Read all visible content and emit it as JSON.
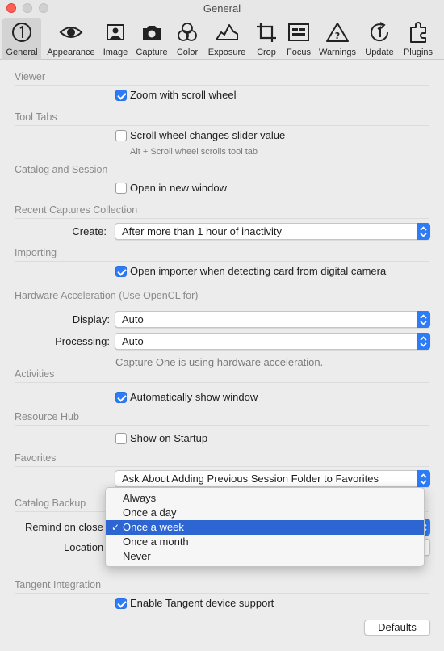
{
  "window": {
    "title": "General"
  },
  "toolbar": {
    "tabs": [
      {
        "label": "General",
        "icon": "general-icon"
      },
      {
        "label": "Appearance",
        "icon": "eye-icon"
      },
      {
        "label": "Image",
        "icon": "image-icon"
      },
      {
        "label": "Capture",
        "icon": "camera-icon"
      },
      {
        "label": "Color",
        "icon": "color-icon"
      },
      {
        "label": "Exposure",
        "icon": "exposure-icon"
      },
      {
        "label": "Crop",
        "icon": "crop-icon"
      },
      {
        "label": "Focus",
        "icon": "focus-icon"
      },
      {
        "label": "Warnings",
        "icon": "warning-icon"
      },
      {
        "label": "Update",
        "icon": "update-icon"
      },
      {
        "label": "Plugins",
        "icon": "plugin-icon"
      }
    ],
    "active": "General"
  },
  "viewer": {
    "title": "Viewer",
    "zoom_label": "Zoom with scroll wheel",
    "zoom_checked": true
  },
  "tool_tabs": {
    "title": "Tool Tabs",
    "scroll_label": "Scroll wheel changes slider value",
    "scroll_checked": false,
    "hint": "Alt + Scroll wheel scrolls tool tab"
  },
  "catalog_session": {
    "title": "Catalog and Session",
    "open_label": "Open in new window",
    "open_checked": false
  },
  "recent_captures": {
    "title": "Recent Captures Collection",
    "create_label": "Create:",
    "create_value": "After more than 1 hour of inactivity"
  },
  "importing": {
    "title": "Importing",
    "open_importer_label": "Open importer when detecting card from digital camera",
    "open_importer_checked": true
  },
  "hardware": {
    "title": "Hardware Acceleration (Use OpenCL for)",
    "display_label": "Display:",
    "display_value": "Auto",
    "processing_label": "Processing:",
    "processing_value": "Auto",
    "status": "Capture One is using hardware acceleration."
  },
  "activities": {
    "title": "Activities",
    "show_label": "Automatically show window",
    "show_checked": true
  },
  "resource_hub": {
    "title": "Resource Hub",
    "startup_label": "Show on Startup",
    "startup_checked": false
  },
  "favorites": {
    "title": "Favorites",
    "value": "Ask About Adding Previous Session Folder to Favorites"
  },
  "catalog_backup": {
    "title": "Catalog Backup",
    "remind_label": "Remind on close",
    "location_label": "Location",
    "remind_options": [
      "Always",
      "Once a day",
      "Once a week",
      "Once a month",
      "Never"
    ],
    "remind_selected": "Once a week"
  },
  "tangent": {
    "title": "Tangent Integration",
    "enable_label": "Enable Tangent device support",
    "enable_checked": true
  },
  "footer": {
    "defaults_label": "Defaults"
  },
  "colors": {
    "accent": "#2d7cf6",
    "selection": "#2d66d3",
    "close": "#fe5f57"
  }
}
